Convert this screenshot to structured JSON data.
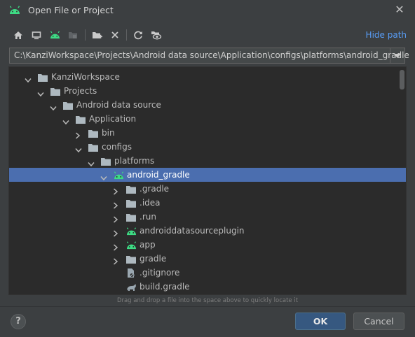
{
  "window": {
    "title": "Open File or Project",
    "app_icon": "android-icon",
    "close_glyph": "✕"
  },
  "toolbar": {
    "icons": [
      "home-icon",
      "desktop-icon",
      "android-project-icon",
      "module-icon",
      "new-folder-icon",
      "delete-icon",
      "refresh-icon",
      "show-hidden-icon"
    ],
    "hide_path_label": "Hide path"
  },
  "path": {
    "value": "C:\\KanziWorkspace\\Projects\\Android data source\\Application\\configs\\platforms\\android_gradle"
  },
  "tree": {
    "rows": [
      {
        "label": "KanziWorkspace",
        "icon": "folder-icon",
        "expanded": true,
        "depth": 0
      },
      {
        "label": "Projects",
        "icon": "folder-icon",
        "expanded": true,
        "depth": 1
      },
      {
        "label": "Android data source",
        "icon": "folder-icon",
        "expanded": true,
        "depth": 2
      },
      {
        "label": "Application",
        "icon": "folder-icon",
        "expanded": true,
        "depth": 3
      },
      {
        "label": "bin",
        "icon": "folder-icon",
        "expanded": false,
        "depth": 4
      },
      {
        "label": "configs",
        "icon": "folder-icon",
        "expanded": true,
        "depth": 4
      },
      {
        "label": "platforms",
        "icon": "folder-icon",
        "expanded": true,
        "depth": 5
      },
      {
        "label": "android_gradle",
        "icon": "android-icon",
        "expanded": true,
        "depth": 6,
        "selected": true
      },
      {
        "label": ".gradle",
        "icon": "folder-icon",
        "expanded": false,
        "depth": 7
      },
      {
        "label": ".idea",
        "icon": "folder-icon",
        "expanded": false,
        "depth": 7
      },
      {
        "label": ".run",
        "icon": "folder-icon",
        "expanded": false,
        "depth": 7
      },
      {
        "label": "androiddatasourceplugin",
        "icon": "android-icon",
        "expanded": false,
        "depth": 7
      },
      {
        "label": "app",
        "icon": "android-icon",
        "expanded": false,
        "depth": 7
      },
      {
        "label": "gradle",
        "icon": "folder-icon",
        "expanded": false,
        "depth": 7
      },
      {
        "label": ".gitignore",
        "icon": "gitignore-file-icon",
        "leaf": true,
        "depth": 7
      },
      {
        "label": "build.gradle",
        "icon": "gradle-file-icon",
        "leaf": true,
        "depth": 7
      }
    ]
  },
  "hint": "Drag and drop a file into the space above to quickly locate it",
  "footer": {
    "help_label": "?",
    "ok_label": "OK",
    "cancel_label": "Cancel"
  },
  "colors": {
    "background": "#3c3f41",
    "tree_background": "#2b2b2b",
    "selection": "#4b6eaf",
    "link": "#589df6",
    "android_green": "#3ddc84",
    "folder": "#aeb9c0",
    "ok_button": "#365880"
  }
}
